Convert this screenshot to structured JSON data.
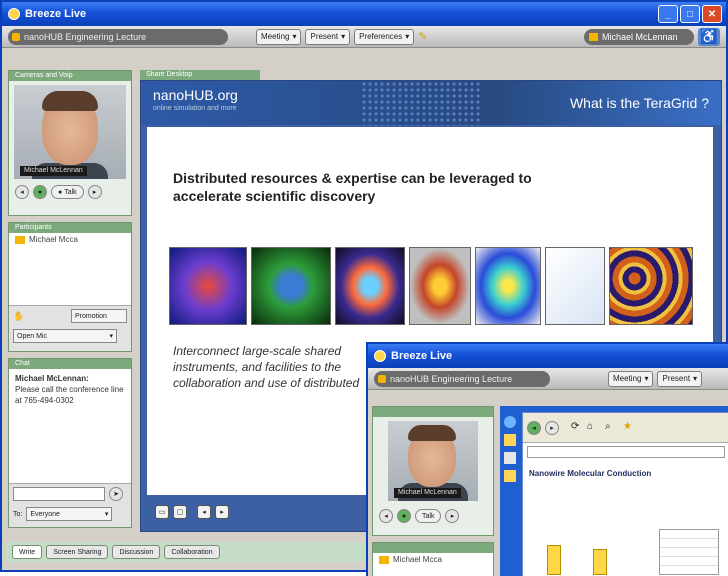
{
  "main_window": {
    "title": "Breeze Live",
    "controls": [
      "_",
      "□",
      "✕"
    ],
    "session": "nanoHUB Engineering Lecture",
    "toolbar": {
      "meeting": "Meeting",
      "present": "Present",
      "preferences": "Preferences"
    },
    "user": "Michael McLennan",
    "camera_panel_title": "Cameras and Voip",
    "camera_name": "Michael McLennan",
    "talk_label": "Talk",
    "participants_title": "Participants",
    "participant": "Michael Mcca",
    "status_select": "Open Mic",
    "status_button": "Promotion",
    "chat_title": "Chat",
    "chat_author": "Michael McLennan:",
    "chat_message": "Please call the conference line at 765-494-0302",
    "chat_to_label": "To:",
    "chat_to_value": "Everyone",
    "share_title": "Share Desktop",
    "tabs": [
      "Write",
      "Screen Sharing",
      "Discussion",
      "Collaboration"
    ]
  },
  "slide": {
    "brand": "nanoHUB.org",
    "brand_sub": "online simulation and more",
    "banner_title": "What is the TeraGrid ?",
    "headline": "Distributed resources & expertise can be leveraged to accelerate scientific discovery",
    "body": "Interconnect large-scale shared instruments, and facilities to the collaboration and use of distributed"
  },
  "second_window": {
    "title": "Breeze Live",
    "session": "nanoHUB Engineering Lecture",
    "meeting": "Meeting",
    "present": "Present",
    "camera_name": "Michael McLennan",
    "talk_label": "Talk",
    "participant": "Michael Mcca",
    "browser_heading": "Nanowire Molecular Conduction"
  },
  "colors": {
    "xp_blue": "#0a3fb8",
    "panel_green": "#7caa7c",
    "slide_blue": "#3d5fa4"
  }
}
